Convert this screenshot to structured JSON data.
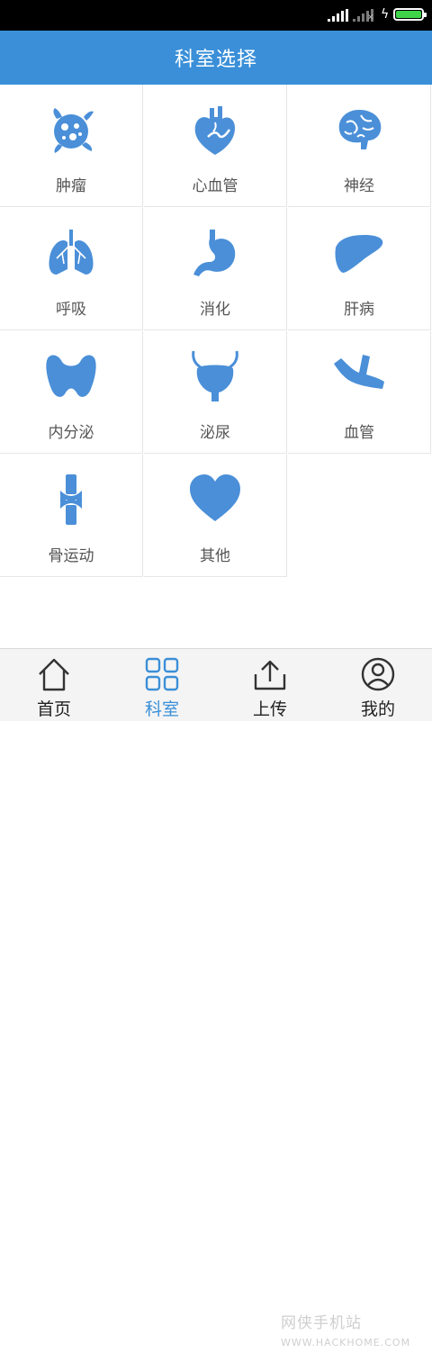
{
  "colors": {
    "primary": "#3a8fd8",
    "battery": "#3fd44a",
    "icon": "#4a8fd8"
  },
  "status_bar": {
    "icons": [
      "signal-icon",
      "signal-no-data-icon",
      "charging-icon",
      "battery-icon"
    ]
  },
  "header": {
    "title": "科室选择"
  },
  "departments": [
    {
      "label": "肿瘤",
      "icon": "tumor-cell-icon"
    },
    {
      "label": "心血管",
      "icon": "heart-organ-icon"
    },
    {
      "label": "神经",
      "icon": "brain-icon"
    },
    {
      "label": "呼吸",
      "icon": "lungs-icon"
    },
    {
      "label": "消化",
      "icon": "stomach-icon"
    },
    {
      "label": "肝病",
      "icon": "liver-icon"
    },
    {
      "label": "内分泌",
      "icon": "thyroid-icon"
    },
    {
      "label": "泌尿",
      "icon": "bladder-icon"
    },
    {
      "label": "血管",
      "icon": "blood-vessel-icon"
    },
    {
      "label": "骨运动",
      "icon": "bone-joint-icon"
    },
    {
      "label": "其他",
      "icon": "heart-icon"
    }
  ],
  "tabbar": {
    "tabs": [
      {
        "label": "首页",
        "icon": "home-icon",
        "active": false
      },
      {
        "label": "科室",
        "icon": "grid-icon",
        "active": true
      },
      {
        "label": "上传",
        "icon": "upload-icon",
        "active": false
      },
      {
        "label": "我的",
        "icon": "profile-icon",
        "active": false
      }
    ]
  },
  "watermark": {
    "text": "网侠手机站",
    "domain": "WWW.HACKHOME.COM"
  }
}
